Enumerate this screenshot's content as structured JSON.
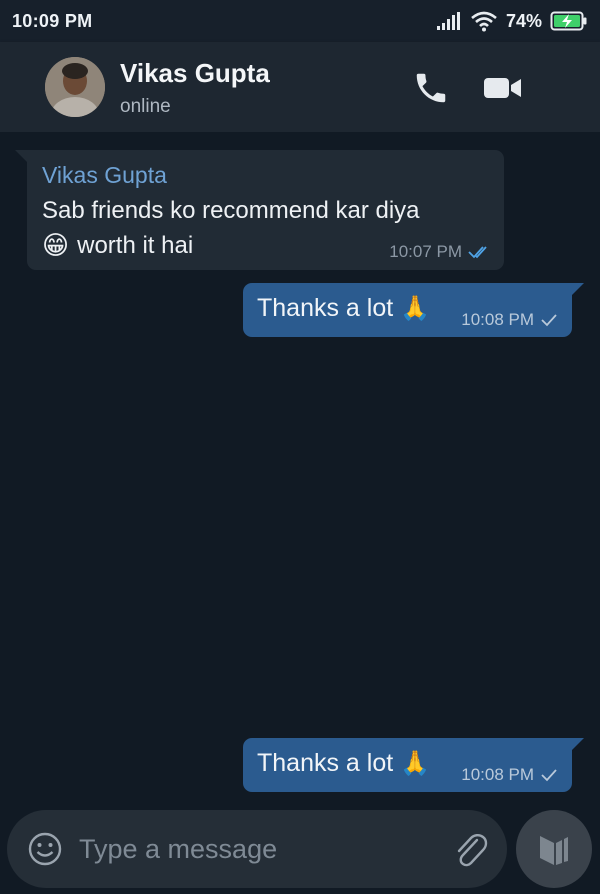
{
  "status_bar": {
    "time": "10:09 PM",
    "battery_percent": "74%",
    "icons": [
      "signal-icon",
      "wifi-icon",
      "battery-charging-icon"
    ]
  },
  "header": {
    "contact_name": "Vikas Gupta",
    "contact_status": "online",
    "icons": [
      "avatar",
      "phone-icon",
      "video-call-icon"
    ]
  },
  "messages": [
    {
      "direction": "incoming",
      "sender": "Vikas Gupta",
      "text_line1": "Sab friends ko recommend kar diya",
      "emoji": "😁",
      "text_line2": "worth it hai",
      "time": "10:07 PM",
      "receipt": "double-check-icon"
    },
    {
      "direction": "outgoing",
      "text": "Thanks a lot",
      "emoji": "🙏",
      "time": "10:08 PM",
      "receipt": "check-icon"
    },
    {
      "direction": "outgoing",
      "text": "Thanks a lot",
      "emoji": "🙏",
      "time": "10:08 PM",
      "receipt": "check-icon"
    }
  ],
  "composer": {
    "placeholder": "Type a message",
    "value": "",
    "icons": [
      "emoji-icon",
      "attach-icon",
      "send-icon"
    ]
  },
  "colors": {
    "background": "#111a24",
    "header": "#1e2731",
    "incoming_bubble": "#212b35",
    "outgoing_bubble": "#2b5b8f",
    "sender_name": "#6fa2d4",
    "read_receipt": "#4fa3e6"
  }
}
